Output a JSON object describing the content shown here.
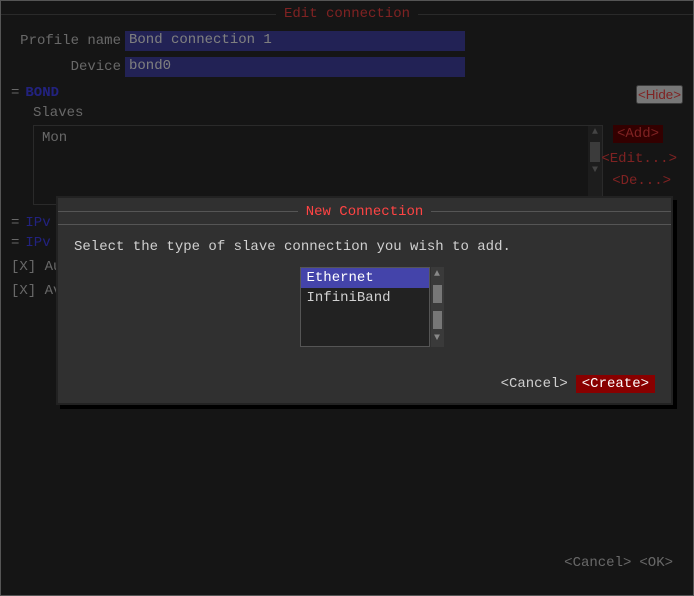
{
  "window": {
    "title": "Edit connection"
  },
  "form": {
    "profile_label": "Profile name",
    "profile_value": "Bond connection 1",
    "device_label": "Device",
    "device_value": "bond0"
  },
  "bond": {
    "marker": "=",
    "title": "BOND",
    "slaves_label": "Slaves",
    "hide_button": "<Hide>"
  },
  "slaves_box": {
    "content": "Mon",
    "add_button": "<Add>",
    "edit_button": "<Edit...>",
    "delete_button": "<De...>"
  },
  "ipv": [
    {
      "marker": "=",
      "label": "IPv"
    },
    {
      "marker": "=",
      "label": "IPv"
    }
  ],
  "checkboxes": [
    "[X] Automatically connect",
    "[X] Available to all users"
  ],
  "bottom_buttons": {
    "cancel": "<Cancel>",
    "ok": "<OK>"
  },
  "modal": {
    "title": "New Connection",
    "description": "Select the type of slave connection you wish to add.",
    "connection_types": [
      {
        "label": "Ethernet",
        "selected": true
      },
      {
        "label": "InfiniBand",
        "selected": false
      }
    ],
    "cancel_button": "<Cancel>",
    "create_button": "<Create>"
  }
}
